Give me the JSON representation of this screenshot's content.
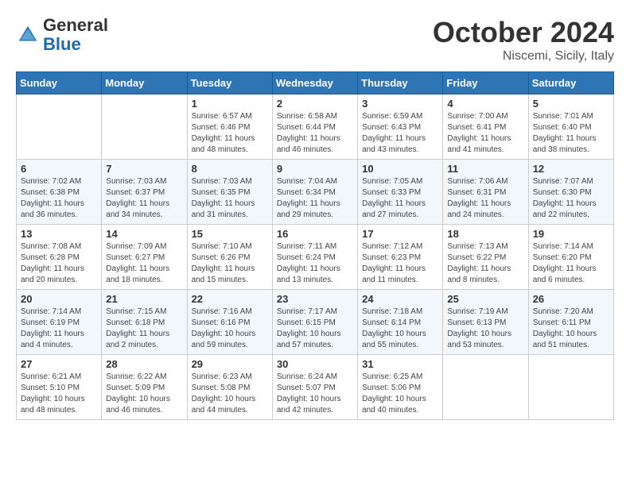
{
  "header": {
    "logo_general": "General",
    "logo_blue": "Blue",
    "month": "October 2024",
    "location": "Niscemi, Sicily, Italy"
  },
  "days_of_week": [
    "Sunday",
    "Monday",
    "Tuesday",
    "Wednesday",
    "Thursday",
    "Friday",
    "Saturday"
  ],
  "weeks": [
    [
      {
        "day": "",
        "info": ""
      },
      {
        "day": "",
        "info": ""
      },
      {
        "day": "1",
        "info": "Sunrise: 6:57 AM\nSunset: 6:46 PM\nDaylight: 11 hours and 48 minutes."
      },
      {
        "day": "2",
        "info": "Sunrise: 6:58 AM\nSunset: 6:44 PM\nDaylight: 11 hours and 46 minutes."
      },
      {
        "day": "3",
        "info": "Sunrise: 6:59 AM\nSunset: 6:43 PM\nDaylight: 11 hours and 43 minutes."
      },
      {
        "day": "4",
        "info": "Sunrise: 7:00 AM\nSunset: 6:41 PM\nDaylight: 11 hours and 41 minutes."
      },
      {
        "day": "5",
        "info": "Sunrise: 7:01 AM\nSunset: 6:40 PM\nDaylight: 11 hours and 38 minutes."
      }
    ],
    [
      {
        "day": "6",
        "info": "Sunrise: 7:02 AM\nSunset: 6:38 PM\nDaylight: 11 hours and 36 minutes."
      },
      {
        "day": "7",
        "info": "Sunrise: 7:03 AM\nSunset: 6:37 PM\nDaylight: 11 hours and 34 minutes."
      },
      {
        "day": "8",
        "info": "Sunrise: 7:03 AM\nSunset: 6:35 PM\nDaylight: 11 hours and 31 minutes."
      },
      {
        "day": "9",
        "info": "Sunrise: 7:04 AM\nSunset: 6:34 PM\nDaylight: 11 hours and 29 minutes."
      },
      {
        "day": "10",
        "info": "Sunrise: 7:05 AM\nSunset: 6:33 PM\nDaylight: 11 hours and 27 minutes."
      },
      {
        "day": "11",
        "info": "Sunrise: 7:06 AM\nSunset: 6:31 PM\nDaylight: 11 hours and 24 minutes."
      },
      {
        "day": "12",
        "info": "Sunrise: 7:07 AM\nSunset: 6:30 PM\nDaylight: 11 hours and 22 minutes."
      }
    ],
    [
      {
        "day": "13",
        "info": "Sunrise: 7:08 AM\nSunset: 6:28 PM\nDaylight: 11 hours and 20 minutes."
      },
      {
        "day": "14",
        "info": "Sunrise: 7:09 AM\nSunset: 6:27 PM\nDaylight: 11 hours and 18 minutes."
      },
      {
        "day": "15",
        "info": "Sunrise: 7:10 AM\nSunset: 6:26 PM\nDaylight: 11 hours and 15 minutes."
      },
      {
        "day": "16",
        "info": "Sunrise: 7:11 AM\nSunset: 6:24 PM\nDaylight: 11 hours and 13 minutes."
      },
      {
        "day": "17",
        "info": "Sunrise: 7:12 AM\nSunset: 6:23 PM\nDaylight: 11 hours and 11 minutes."
      },
      {
        "day": "18",
        "info": "Sunrise: 7:13 AM\nSunset: 6:22 PM\nDaylight: 11 hours and 8 minutes."
      },
      {
        "day": "19",
        "info": "Sunrise: 7:14 AM\nSunset: 6:20 PM\nDaylight: 11 hours and 6 minutes."
      }
    ],
    [
      {
        "day": "20",
        "info": "Sunrise: 7:14 AM\nSunset: 6:19 PM\nDaylight: 11 hours and 4 minutes."
      },
      {
        "day": "21",
        "info": "Sunrise: 7:15 AM\nSunset: 6:18 PM\nDaylight: 11 hours and 2 minutes."
      },
      {
        "day": "22",
        "info": "Sunrise: 7:16 AM\nSunset: 6:16 PM\nDaylight: 10 hours and 59 minutes."
      },
      {
        "day": "23",
        "info": "Sunrise: 7:17 AM\nSunset: 6:15 PM\nDaylight: 10 hours and 57 minutes."
      },
      {
        "day": "24",
        "info": "Sunrise: 7:18 AM\nSunset: 6:14 PM\nDaylight: 10 hours and 55 minutes."
      },
      {
        "day": "25",
        "info": "Sunrise: 7:19 AM\nSunset: 6:13 PM\nDaylight: 10 hours and 53 minutes."
      },
      {
        "day": "26",
        "info": "Sunrise: 7:20 AM\nSunset: 6:11 PM\nDaylight: 10 hours and 51 minutes."
      }
    ],
    [
      {
        "day": "27",
        "info": "Sunrise: 6:21 AM\nSunset: 5:10 PM\nDaylight: 10 hours and 48 minutes."
      },
      {
        "day": "28",
        "info": "Sunrise: 6:22 AM\nSunset: 5:09 PM\nDaylight: 10 hours and 46 minutes."
      },
      {
        "day": "29",
        "info": "Sunrise: 6:23 AM\nSunset: 5:08 PM\nDaylight: 10 hours and 44 minutes."
      },
      {
        "day": "30",
        "info": "Sunrise: 6:24 AM\nSunset: 5:07 PM\nDaylight: 10 hours and 42 minutes."
      },
      {
        "day": "31",
        "info": "Sunrise: 6:25 AM\nSunset: 5:06 PM\nDaylight: 10 hours and 40 minutes."
      },
      {
        "day": "",
        "info": ""
      },
      {
        "day": "",
        "info": ""
      }
    ]
  ]
}
